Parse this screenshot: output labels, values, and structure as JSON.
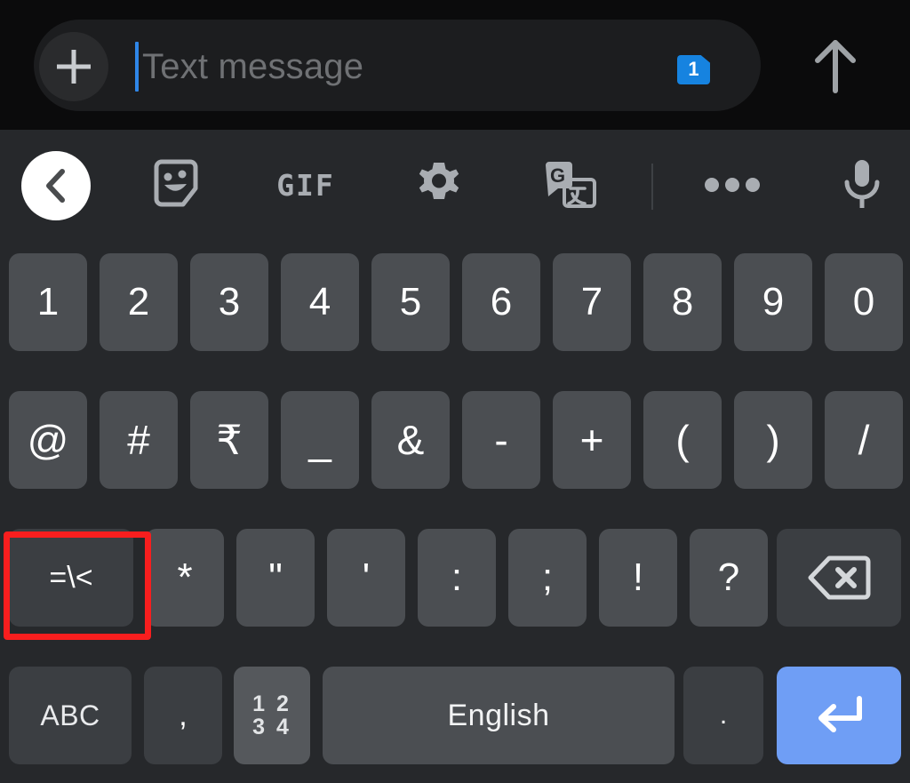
{
  "compose": {
    "add_icon": "plus-icon",
    "placeholder": "Text message",
    "input_value": "",
    "sim_badge": "1",
    "send_icon": "arrow-up-icon"
  },
  "keyboard": {
    "toolbar": [
      {
        "name": "back-to-keyboard-button",
        "icon": "chevron-left-icon",
        "label": ""
      },
      {
        "name": "sticker-button",
        "icon": "sticker-icon",
        "label": ""
      },
      {
        "name": "gif-button",
        "icon": "gif-icon",
        "label": "GIF"
      },
      {
        "name": "settings-button",
        "icon": "gear-icon",
        "label": ""
      },
      {
        "name": "translate-button",
        "icon": "google-translate-icon",
        "label": ""
      },
      {
        "name": "more-options-button",
        "icon": "overflow-dots-icon",
        "label": ""
      },
      {
        "name": "voice-input-button",
        "icon": "microphone-icon",
        "label": ""
      }
    ],
    "row_numbers": [
      "1",
      "2",
      "3",
      "4",
      "5",
      "6",
      "7",
      "8",
      "9",
      "0"
    ],
    "row_symbols": [
      "@",
      "#",
      "₹",
      "_",
      "&",
      "-",
      "+",
      "(",
      ")",
      "/"
    ],
    "row_symbols2": [
      "=\\<",
      "*",
      "\"",
      "'",
      ":",
      ";",
      "!",
      "?"
    ],
    "backspace_icon": "backspace-icon",
    "bottom_row": {
      "abc_label": "ABC",
      "comma_label": ",",
      "numeric_label": "1 2\n3 4",
      "numeric_line1": "1 2",
      "numeric_line2": "3 4",
      "space_label": "English",
      "period_label": ".",
      "enter_icon": "enter-return-icon"
    }
  },
  "annotation": {
    "highlight_target": "=\\<",
    "highlight_color": "#f81e1e"
  }
}
